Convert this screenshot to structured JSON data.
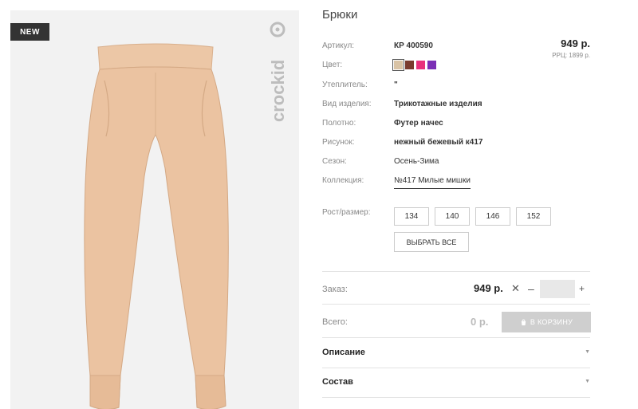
{
  "badge": "NEW",
  "brand_text": "crockid",
  "product": {
    "title": "Брюки",
    "price": "949 р.",
    "rrc": "РРЦ: 1899 р."
  },
  "details": [
    {
      "label": "Артикул:",
      "value": "КР 400590",
      "style": "bold"
    },
    {
      "label": "Цвет:",
      "value": "",
      "style": "swatches"
    },
    {
      "label": "Утеплитель:",
      "value": "\"",
      "style": "bold"
    },
    {
      "label": "Вид изделия:",
      "value": "Трикотажные изделия",
      "style": "bold"
    },
    {
      "label": "Полотно:",
      "value": "Футер начес",
      "style": "bold"
    },
    {
      "label": "Рисунок:",
      "value": "нежный бежевый к417",
      "style": "bold"
    },
    {
      "label": "Сезон:",
      "value": "Осень-Зима",
      "style": "normal"
    },
    {
      "label": "Коллекция:",
      "value": "№417 Милые мишки",
      "style": "link"
    }
  ],
  "colors": [
    "#d9c3a5",
    "#7a3b2e",
    "#e8327c",
    "#7b2fb5"
  ],
  "sizes": {
    "label": "Рост/размер:",
    "options": [
      "134",
      "140",
      "146",
      "152"
    ],
    "select_all": "ВЫБРАТЬ ВСЕ"
  },
  "order": {
    "label": "Заказ:",
    "price": "949 р.",
    "times": "✕",
    "minus": "–",
    "plus": "+",
    "quantity": ""
  },
  "total": {
    "label": "Всего:",
    "value": "0 р.",
    "cart_button": "В КОРЗИНУ"
  },
  "accordion": [
    "Описание",
    "Состав"
  ]
}
